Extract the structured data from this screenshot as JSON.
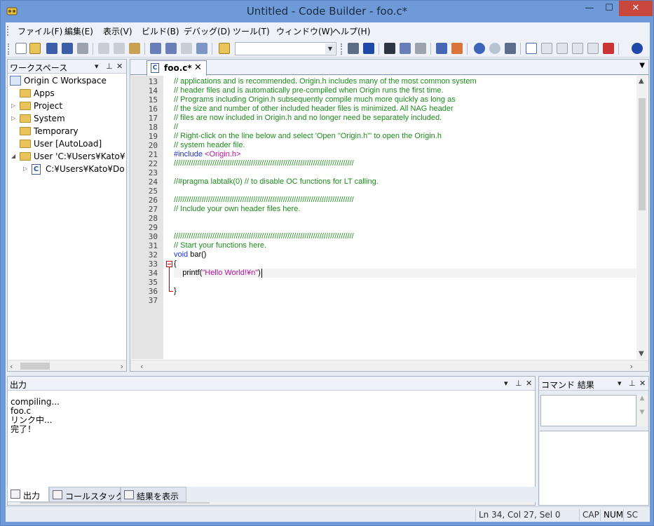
{
  "window": {
    "title": "Untitled - Code Builder - foo.c*",
    "controls": {
      "minimize": "—",
      "maximize": "☐",
      "close": "✕"
    }
  },
  "menu": {
    "items": [
      "ファイル(F)",
      "編集(E)",
      "表示(V)",
      "ビルド(B)",
      "デバッグ(D)",
      "ツール(T)",
      "ウィンドウ(W)",
      "ヘルプ(H)"
    ]
  },
  "toolbar": {
    "combo_value": "",
    "icons": [
      "new-file-icon",
      "open-folder-icon",
      "save-icon",
      "save-all-icon",
      "print-icon",
      "cut-icon",
      "copy-icon",
      "paste-icon",
      "build-icon",
      "rebuild-icon",
      "batch-build-icon",
      "add-to-workspace-icon",
      "open-project-icon",
      "indent-icon",
      "outdent-icon",
      "find-icon",
      "replace-icon",
      "find-in-files-icon",
      "tools-icon",
      "debug-icon",
      "undo-icon",
      "redo-icon",
      "select-icon",
      "window-icon",
      "comment-icon",
      "bookmark-icon",
      "breakpoint-icon",
      "navigate-back-icon"
    ]
  },
  "workspace": {
    "title": "ワークスペース",
    "pin": "▾",
    "dock": "⊥",
    "close": "✕",
    "items": [
      {
        "label": "Origin C Workspace",
        "level": 0,
        "kind": "workspace"
      },
      {
        "label": "Apps",
        "level": 1,
        "kind": "folder"
      },
      {
        "label": "Project",
        "level": 1,
        "kind": "folder",
        "expander": "▷"
      },
      {
        "label": "System",
        "level": 1,
        "kind": "folder",
        "expander": "▷"
      },
      {
        "label": "Temporary",
        "level": 1,
        "kind": "folder"
      },
      {
        "label": "User  [AutoLoad]",
        "level": 1,
        "kind": "folder"
      },
      {
        "label": "User 'C:¥Users¥Kato¥",
        "level": 1,
        "kind": "folder",
        "expander": "◢"
      },
      {
        "label": "C:¥Users¥Kato¥Do",
        "level": 2,
        "kind": "cfile",
        "expander": "▷"
      }
    ]
  },
  "editor": {
    "tab_label": "foo.c*",
    "tab_close": "✕",
    "tab_icon": "C",
    "lines": [
      {
        "n": "13",
        "parts": [
          {
            "t": "// applications and is recommended. Origin.h includes many of the most common system",
            "c": "comment"
          }
        ]
      },
      {
        "n": "14",
        "parts": [
          {
            "t": "// header files and is automatically pre-compiled when Origin runs the first time.",
            "c": "comment"
          }
        ]
      },
      {
        "n": "15",
        "parts": [
          {
            "t": "// Programs including Origin.h subsequently compile much more quickly as long as",
            "c": "comment"
          }
        ]
      },
      {
        "n": "16",
        "parts": [
          {
            "t": "// the size and number of other included header files is minimized. All NAG header",
            "c": "comment"
          }
        ]
      },
      {
        "n": "17",
        "parts": [
          {
            "t": "// files are now included in Origin.h and no longer need be separately included.",
            "c": "comment"
          }
        ]
      },
      {
        "n": "18",
        "parts": [
          {
            "t": "//",
            "c": "comment"
          }
        ]
      },
      {
        "n": "19",
        "parts": [
          {
            "t": "// Right-click on the line below and select 'Open \"Origin.h\"' to open the Origin.h",
            "c": "comment"
          }
        ]
      },
      {
        "n": "20",
        "parts": [
          {
            "t": "// system header file.",
            "c": "comment"
          }
        ]
      },
      {
        "n": "21",
        "parts": [
          {
            "t": "#include ",
            "c": "kw"
          },
          {
            "t": "<Origin.h>",
            "c": "str"
          }
        ]
      },
      {
        "n": "22",
        "parts": [
          {
            "t": "////////////////////////////////////////////////////////////////////////////////////",
            "c": "comment"
          }
        ]
      },
      {
        "n": "23",
        "parts": []
      },
      {
        "n": "24",
        "parts": [
          {
            "t": "//#pragma labtalk(0) // to disable OC functions for LT calling.",
            "c": "comment"
          }
        ]
      },
      {
        "n": "25",
        "parts": []
      },
      {
        "n": "26",
        "parts": [
          {
            "t": "////////////////////////////////////////////////////////////////////////////////////",
            "c": "comment"
          }
        ]
      },
      {
        "n": "27",
        "parts": [
          {
            "t": "// Include your own header files here.",
            "c": "comment"
          }
        ]
      },
      {
        "n": "28",
        "parts": []
      },
      {
        "n": "29",
        "parts": []
      },
      {
        "n": "30",
        "parts": [
          {
            "t": "////////////////////////////////////////////////////////////////////////////////////",
            "c": "comment"
          }
        ]
      },
      {
        "n": "31",
        "parts": [
          {
            "t": "// Start your functions here.",
            "c": "comment"
          }
        ]
      },
      {
        "n": "32",
        "parts": [
          {
            "t": "void",
            "c": "kw"
          },
          {
            "t": " bar()",
            "c": "plain"
          }
        ]
      },
      {
        "n": "33",
        "parts": [
          {
            "t": "{",
            "c": "plain"
          }
        ]
      },
      {
        "n": "34",
        "parts": [
          {
            "t": "    printf(",
            "c": "plain"
          },
          {
            "t": "\"Hello World!¥n\"",
            "c": "str"
          },
          {
            "t": ")",
            "c": "plain"
          }
        ]
      },
      {
        "n": "35",
        "parts": []
      },
      {
        "n": "36",
        "parts": [
          {
            "t": "}",
            "c": "plain"
          }
        ]
      },
      {
        "n": "37",
        "parts": []
      }
    ],
    "fold_marker": "⊟",
    "current_line": "34"
  },
  "output": {
    "title": "出力",
    "lines": [
      "compiling...",
      "foo.c",
      "リンク中...",
      "完了！"
    ],
    "tabs": [
      {
        "label": "出力",
        "active": true
      },
      {
        "label": "コールスタック",
        "active": false
      },
      {
        "label": "結果を表示",
        "active": false
      }
    ]
  },
  "command": {
    "title": "コマンド 結果"
  },
  "status": {
    "position": "Ln 34, Col 27, Sel 0",
    "cap": "CAP",
    "num": "NUM",
    "scrl": "SC"
  },
  "colors": {
    "comment": "#1c8c1c",
    "keyword": "#1c2fd6",
    "string": "#b3139f",
    "titlebar": "#6f9ad8",
    "close": "#c9463d"
  }
}
